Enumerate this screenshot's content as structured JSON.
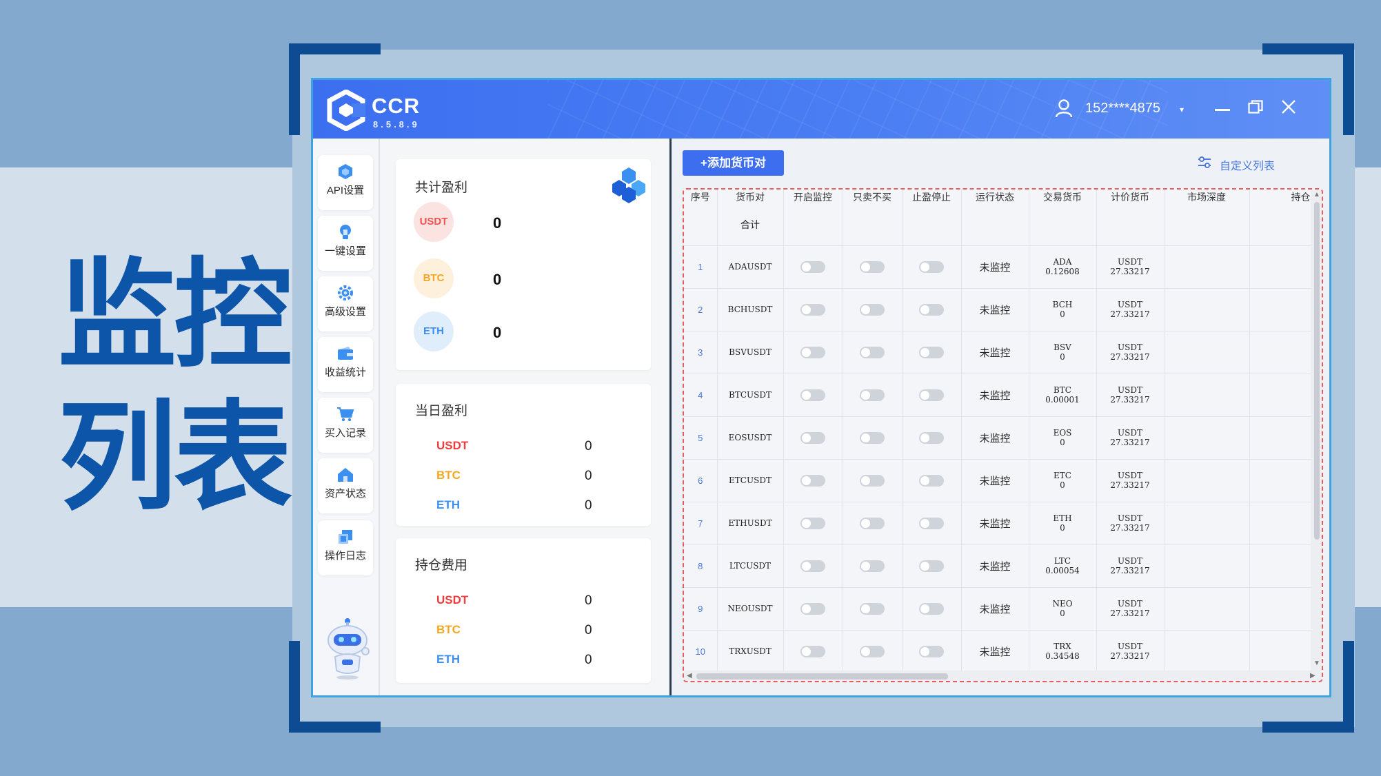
{
  "poster": {
    "title_line1": "监控",
    "title_line2": "列表"
  },
  "titlebar": {
    "app_name": "CCR",
    "version": "8.5.8.9",
    "user": "152****4875",
    "dropdown_arrow": "▾",
    "icons": [
      "ccr-logo-icon",
      "user-icon",
      "minimize-icon",
      "maximize-icon",
      "close-icon"
    ]
  },
  "sidebar": {
    "items": [
      {
        "label": "API设置",
        "icon": "api-icon"
      },
      {
        "label": "一键设置",
        "icon": "lightbulb-icon"
      },
      {
        "label": "高级设置",
        "icon": "gear-icon"
      },
      {
        "label": "收益统计",
        "icon": "wallet-icon"
      },
      {
        "label": "买入记录",
        "icon": "cart-icon"
      },
      {
        "label": "资产状态",
        "icon": "home-icon"
      },
      {
        "label": "操作日志",
        "icon": "log-icon"
      }
    ],
    "assistant_icon": "robot-icon"
  },
  "summary": {
    "total": {
      "title": "共计盈利",
      "usdt_label": "USDT",
      "usdt_value": "0",
      "btc_label": "BTC",
      "btc_value": "0",
      "eth_label": "ETH",
      "eth_value": "0"
    },
    "daily": {
      "title": "当日盈利",
      "usdt_label": "USDT",
      "usdt_value": "0",
      "btc_label": "BTC",
      "btc_value": "0",
      "eth_label": "ETH",
      "eth_value": "0"
    },
    "position_fee": {
      "title": "持仓费用",
      "usdt_label": "USDT",
      "usdt_value": "0",
      "btc_label": "BTC",
      "btc_value": "0",
      "eth_label": "ETH",
      "eth_value": "0"
    }
  },
  "toolbar": {
    "add_label": "+添加货币对",
    "custom_label": "自定义列表"
  },
  "table": {
    "headers": {
      "index": "序号",
      "pair": "货币对",
      "monitor": "开启监控",
      "sell_only": "只卖不买",
      "stop": "止盈停止",
      "status": "运行状态",
      "trade_coin": "交易货币",
      "quote_coin": "计价货币",
      "depth": "市场深度",
      "position": "持仓"
    },
    "total_label": "合计",
    "rows": [
      {
        "index": "1",
        "pair": "ADAUSDT",
        "status": "未监控",
        "trade_coin": "ADA",
        "trade_amount": "0.12608",
        "quote_coin": "USDT",
        "quote_amount": "27.33217"
      },
      {
        "index": "2",
        "pair": "BCHUSDT",
        "status": "未监控",
        "trade_coin": "BCH",
        "trade_amount": "0",
        "quote_coin": "USDT",
        "quote_amount": "27.33217"
      },
      {
        "index": "3",
        "pair": "BSVUSDT",
        "status": "未监控",
        "trade_coin": "BSV",
        "trade_amount": "0",
        "quote_coin": "USDT",
        "quote_amount": "27.33217"
      },
      {
        "index": "4",
        "pair": "BTCUSDT",
        "status": "未监控",
        "trade_coin": "BTC",
        "trade_amount": "0.00001",
        "quote_coin": "USDT",
        "quote_amount": "27.33217"
      },
      {
        "index": "5",
        "pair": "EOSUSDT",
        "status": "未监控",
        "trade_coin": "EOS",
        "trade_amount": "0",
        "quote_coin": "USDT",
        "quote_amount": "27.33217"
      },
      {
        "index": "6",
        "pair": "ETCUSDT",
        "status": "未监控",
        "trade_coin": "ETC",
        "trade_amount": "0",
        "quote_coin": "USDT",
        "quote_amount": "27.33217"
      },
      {
        "index": "7",
        "pair": "ETHUSDT",
        "status": "未监控",
        "trade_coin": "ETH",
        "trade_amount": "0",
        "quote_coin": "USDT",
        "quote_amount": "27.33217"
      },
      {
        "index": "8",
        "pair": "LTCUSDT",
        "status": "未监控",
        "trade_coin": "LTC",
        "trade_amount": "0.00054",
        "quote_coin": "USDT",
        "quote_amount": "27.33217"
      },
      {
        "index": "9",
        "pair": "NEOUSDT",
        "status": "未监控",
        "trade_coin": "NEO",
        "trade_amount": "0",
        "quote_coin": "USDT",
        "quote_amount": "27.33217"
      },
      {
        "index": "10",
        "pair": "TRXUSDT",
        "status": "未监控",
        "trade_coin": "TRX",
        "trade_amount": "0.34548",
        "quote_coin": "USDT",
        "quote_amount": "27.33217"
      }
    ]
  },
  "colors": {
    "brand_blue": "#3d6ef0",
    "poster_title": "#0c55a8",
    "usdt": "#ef3b3b",
    "btc": "#f5a623",
    "eth": "#3b8ff0",
    "dashed_border": "#e65b5b"
  }
}
